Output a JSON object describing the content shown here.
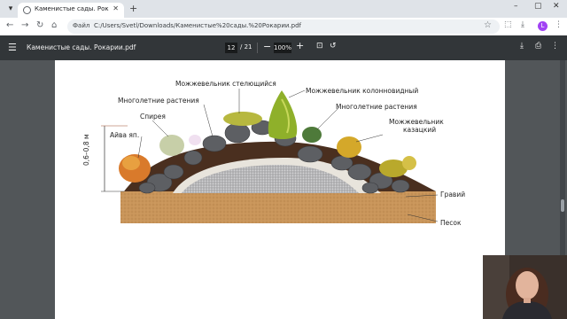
{
  "browser": {
    "tab": {
      "title": "Каменистые сады. Рокарии.pdf"
    },
    "omnibox": {
      "chip": "Файл",
      "url": "C:/Users/Svetl/Downloads/Каменистые%20сады.%20Рокарии.pdf"
    },
    "profile_initial": "L"
  },
  "pdf_toolbar": {
    "doc_title": "Каменистые сады. Рокарии.pdf",
    "current_page": "12",
    "page_total": "/ 21",
    "zoom": "100%"
  },
  "figure": {
    "labels": {
      "creeping_juniper": "Можжевельник стелющийся",
      "perennials_left": "Многолетние растения",
      "spiraea": "Спирея",
      "quince": "Айва яп.",
      "height": "0,6–0,8 м",
      "columnar_juniper": "Можжевельник колонновидный",
      "perennials_right": "Многолетние растения",
      "cossack_juniper_1": "Можжевельник",
      "cossack_juniper_2": "казацкий",
      "gravel": "Гравий",
      "sand": "Песок"
    }
  },
  "colors": {
    "page_bg": "#ffffff",
    "viewer_bg": "#525659",
    "pdf_toolbar": "#323639",
    "sand": "#c9955a",
    "soil": "#4a2f1f",
    "gravel_core": "#b9b9bb"
  }
}
